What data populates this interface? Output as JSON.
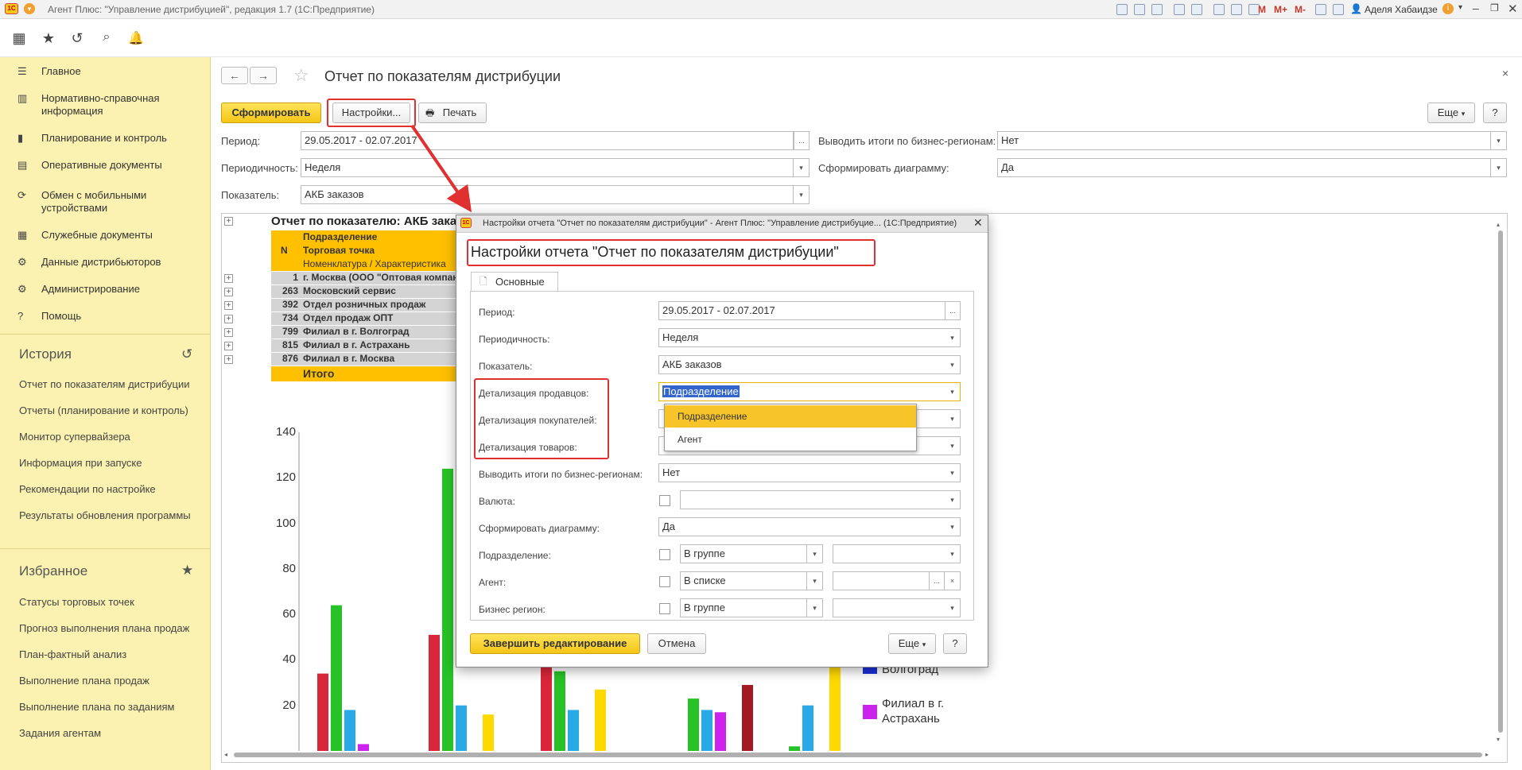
{
  "app": {
    "title": "Агент Плюс: \"Управление дистрибуцией\", редакция 1.7  (1С:Предприятие)",
    "user": "Аделя Хабаидзе",
    "toolbar_text": [
      "M",
      "M+",
      "M-"
    ]
  },
  "commands": [
    "apps-icon",
    "star-icon",
    "history-icon",
    "search-icon",
    "bell-icon"
  ],
  "sidebar": {
    "sections": [
      {
        "icon": "☰",
        "label": "Главное"
      },
      {
        "icon": "▥",
        "label": "Нормативно-справочная информация"
      },
      {
        "icon": "▮",
        "label": "Планирование и контроль"
      },
      {
        "icon": "▤",
        "label": "Оперативные документы"
      },
      {
        "icon": "⟳",
        "label": "Обмен с мобильными устройствами"
      },
      {
        "icon": "▦",
        "label": "Служебные документы"
      },
      {
        "icon": "⚙",
        "label": "Данные дистрибьюторов"
      },
      {
        "icon": "⚙",
        "label": "Администрирование"
      },
      {
        "icon": "?",
        "label": "Помощь"
      }
    ],
    "history": {
      "title": "История",
      "items": [
        "Отчет по показателям дистрибуции",
        "Отчеты (планирование и контроль)",
        "Монитор супервайзера",
        "Информация при запуске",
        "Рекомендации по настройке",
        "Результаты обновления программы"
      ]
    },
    "favorites": {
      "title": "Избранное",
      "items": [
        "Статусы торговых точек",
        "Прогноз выполнения плана продаж",
        "План-фактный анализ",
        "Выполнение плана продаж",
        "Выполнение плана по заданиям",
        "Задания агентам"
      ]
    }
  },
  "page": {
    "title": "Отчет по показателям дистрибуции",
    "buttons": {
      "generate": "Сформировать",
      "settings": "Настройки...",
      "print": "Печать",
      "more": "Еще",
      "help": "?"
    },
    "filters": {
      "period_label": "Период:",
      "period_value": "29.05.2017 - 02.07.2017",
      "periodicity_label": "Периодичность:",
      "periodicity_value": "Неделя",
      "indicator_label": "Показатель:",
      "indicator_value": "АКБ заказов",
      "totals_label": "Выводить итоги по бизнес-регионам:",
      "totals_value": "Нет",
      "chart_label": "Сформировать диаграмму:",
      "chart_value": "Да",
      "ellipsis": "..."
    }
  },
  "report": {
    "title": "Отчет по показателю: АКБ заказов",
    "header_n": "N",
    "headers": [
      "Подразделение",
      "Торговая точка",
      "Номенклатура / Характеристика"
    ],
    "rows": [
      {
        "n": "1",
        "name": "г. Москва  (ООО \"Оптовая компания\")"
      },
      {
        "n": "263",
        "name": "Московский сервис"
      },
      {
        "n": "392",
        "name": "Отдел розничных продаж"
      },
      {
        "n": "734",
        "name": "Отдел продаж ОПТ"
      },
      {
        "n": "799",
        "name": "Филиал в г. Волгоград"
      },
      {
        "n": "815",
        "name": "Филиал в г. Астрахань"
      },
      {
        "n": "876",
        "name": "Филиал в г. Москва"
      }
    ],
    "total": "Итого",
    "legend": [
      "Волгоград",
      "Филиал в г. Астрахань"
    ]
  },
  "chart_data": {
    "type": "bar",
    "ylim": [
      0,
      140
    ],
    "yticks": [
      20,
      40,
      60,
      80,
      100,
      120,
      140
    ],
    "series": [
      {
        "color": "#d9263a",
        "values": [
          34,
          51,
          42,
          0,
          0
        ]
      },
      {
        "color": "#27c227",
        "values": [
          64,
          124,
          35,
          23,
          2
        ]
      },
      {
        "color": "#29a9e6",
        "values": [
          18,
          20,
          18,
          18,
          20
        ]
      },
      {
        "color": "#cc22ee",
        "values": [
          3,
          0,
          0,
          17,
          0
        ]
      },
      {
        "color": "#ffd900",
        "values": [
          0,
          16,
          27,
          0,
          37
        ]
      },
      {
        "color": "#a31a24",
        "values": [
          0,
          0,
          0,
          29,
          0
        ]
      }
    ],
    "legend": [
      {
        "name": "Волгоград",
        "color": "#1a2fd9"
      },
      {
        "name": "Филиал в г. Астрахань",
        "color": "#cc22ee"
      }
    ]
  },
  "dialog": {
    "window_title": "Настройки отчета \"Отчет по показателям дистрибуции\" - Агент Плюс: \"Управление дистрибуцие...  (1С:Предприятие)",
    "heading": "Настройки отчета \"Отчет по показателям дистрибуции\"",
    "tab": "Основные",
    "fields": {
      "period": {
        "label": "Период:",
        "value": "29.05.2017 - 02.07.2017"
      },
      "periodicity": {
        "label": "Периодичность:",
        "value": "Неделя"
      },
      "indicator": {
        "label": "Показатель:",
        "value": "АКБ заказов"
      },
      "seller_detail": {
        "label": "Детализация продавцов:",
        "value": "Подразделение"
      },
      "buyer_detail": {
        "label": "Детализация покупателей:"
      },
      "goods_detail": {
        "label": "Детализация товаров:"
      },
      "totals": {
        "label": "Выводить итоги по бизнес-регионам:",
        "value": "Нет"
      },
      "currency": {
        "label": "Валюта:"
      },
      "chart": {
        "label": "Сформировать диаграмму:",
        "value": "Да"
      },
      "department": {
        "label": "Подразделение:",
        "cond": "В группе"
      },
      "agent": {
        "label": "Агент:",
        "cond": "В списке"
      },
      "region": {
        "label": "Бизнес регион:",
        "cond": "В группе"
      }
    },
    "popup_options": [
      "Подразделение",
      "Агент"
    ],
    "buttons": {
      "finish": "Завершить редактирование",
      "cancel": "Отмена",
      "more": "Еще",
      "help": "?",
      "clear": "×",
      "ellipsis": "..."
    }
  }
}
